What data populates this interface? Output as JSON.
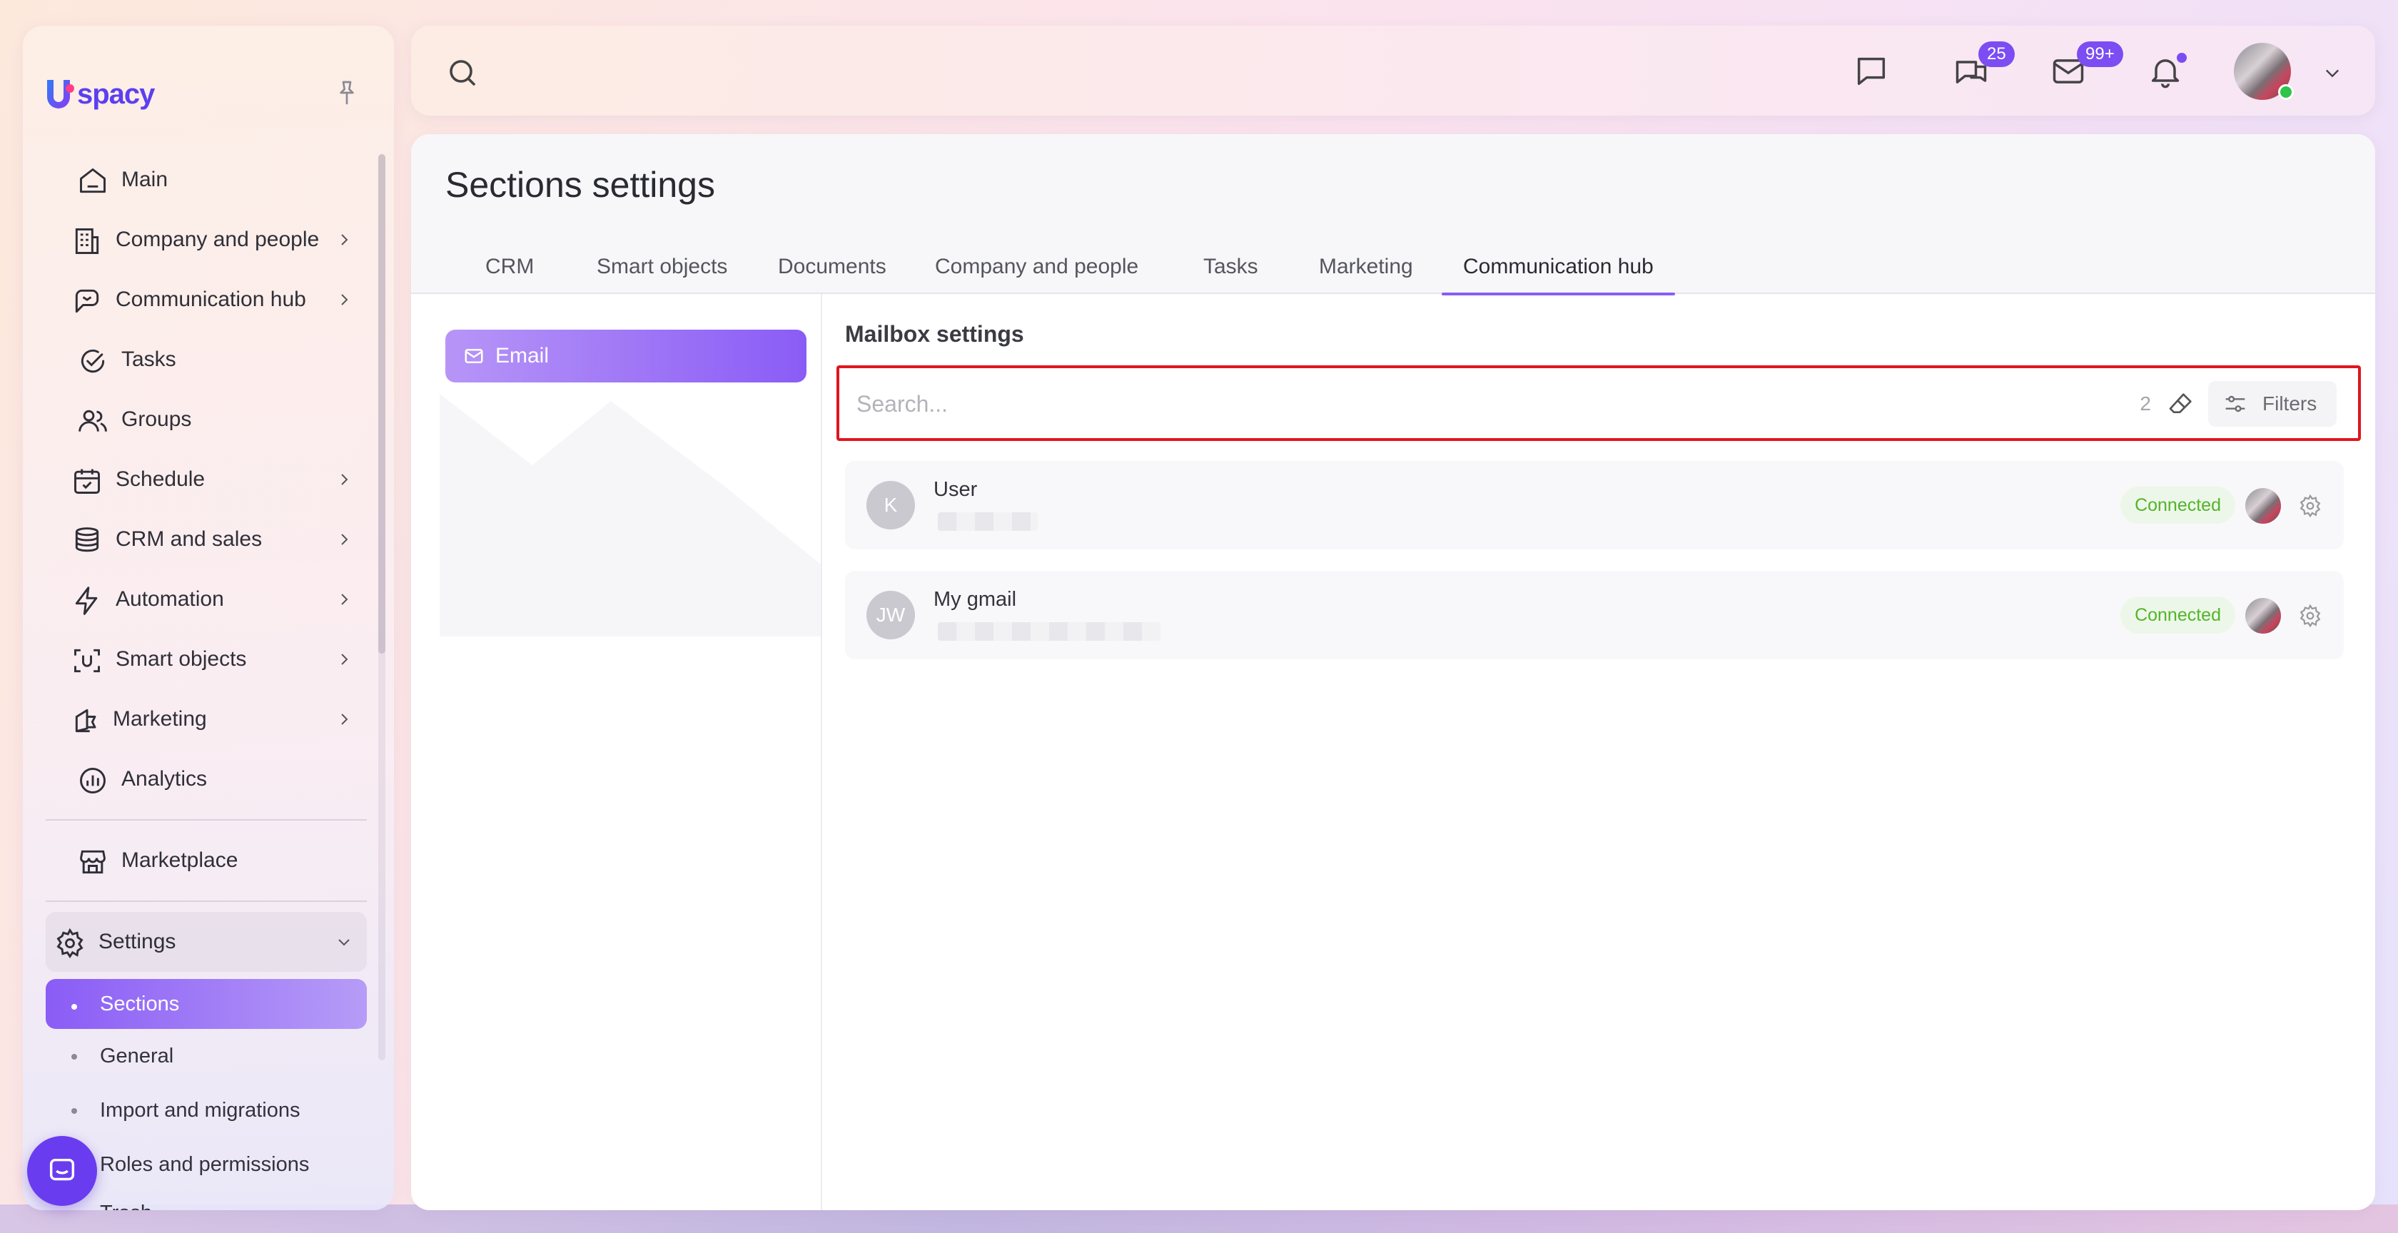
{
  "app": {
    "brand": "spacy",
    "accent": "#8a5cf6"
  },
  "sidebar": {
    "items": [
      {
        "label": "Main",
        "icon": "home-icon",
        "expandable": false
      },
      {
        "label": "Company and people",
        "icon": "building-icon",
        "expandable": true
      },
      {
        "label": "Communication hub",
        "icon": "communication-icon",
        "expandable": true
      },
      {
        "label": "Tasks",
        "icon": "check-circle-icon",
        "expandable": false
      },
      {
        "label": "Groups",
        "icon": "users-icon",
        "expandable": false
      },
      {
        "label": "Schedule",
        "icon": "calendar-icon",
        "expandable": true
      },
      {
        "label": "CRM and sales",
        "icon": "database-icon",
        "expandable": true
      },
      {
        "label": "Automation",
        "icon": "lightning-icon",
        "expandable": true
      },
      {
        "label": "Smart objects",
        "icon": "scan-icon",
        "expandable": true
      },
      {
        "label": "Marketing",
        "icon": "megaphone-icon",
        "expandable": true
      },
      {
        "label": "Analytics",
        "icon": "chart-icon",
        "expandable": false
      }
    ],
    "marketplace": "Marketplace",
    "settings": "Settings",
    "settings_sub": [
      "Sections",
      "General",
      "Import and migrations",
      "Roles and permissions",
      "Trash"
    ]
  },
  "topbar": {
    "chats_badge": "25",
    "mail_badge": "99+"
  },
  "page": {
    "title": "Sections settings",
    "tabs": [
      "CRM",
      "Smart objects",
      "Documents",
      "Company and people",
      "Tasks",
      "Marketing",
      "Communication hub"
    ],
    "active_tab": "Communication hub",
    "left_menu_email": "Email",
    "section_title": "Mailbox settings",
    "search_placeholder": "Search...",
    "result_count": "2",
    "filters_label": "Filters",
    "mailboxes": [
      {
        "initials": "K",
        "name": "User",
        "status": "Connected"
      },
      {
        "initials": "JW",
        "name": "My gmail",
        "status": "Connected"
      }
    ]
  }
}
